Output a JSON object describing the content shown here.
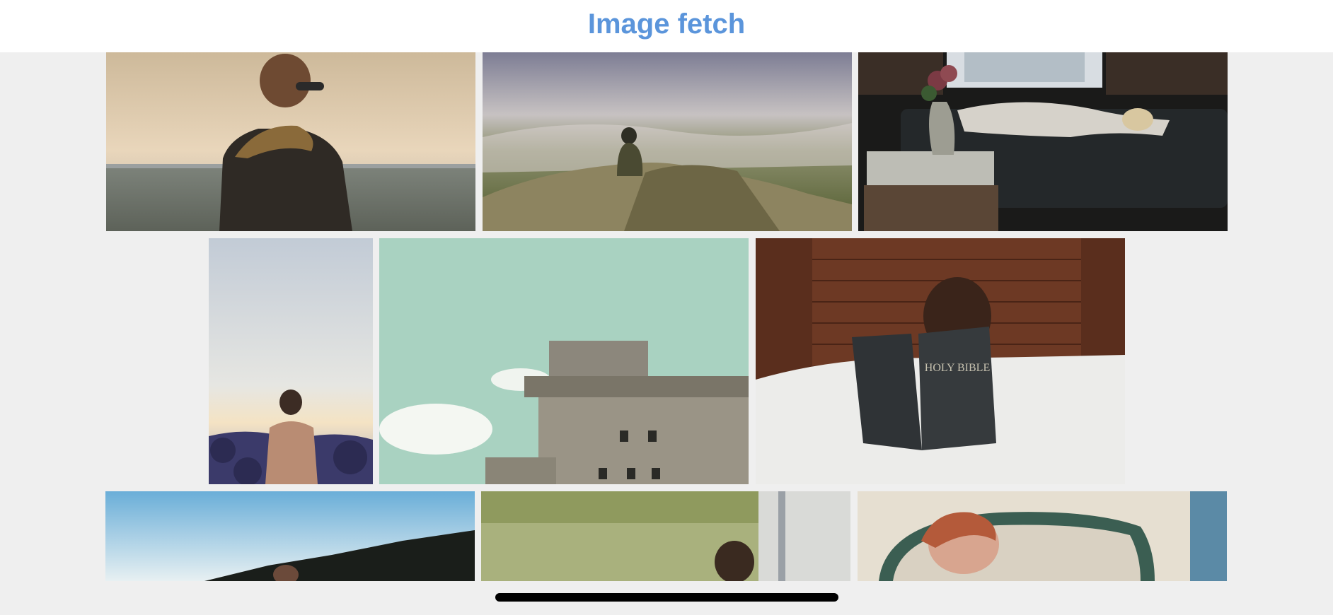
{
  "header": {
    "title": "Image fetch",
    "title_color": "#5b95db"
  },
  "gallery": {
    "photos": [
      {
        "subject": "man-in-scarf-by-sea"
      },
      {
        "subject": "hiker-with-dog-on-misty-mountain"
      },
      {
        "subject": "woman-sleeping-on-sofa"
      },
      {
        "subject": "shirtless-man-on-rocky-shore"
      },
      {
        "subject": "concrete-bunker-building"
      },
      {
        "subject": "child-reading-bible",
        "cover_text": "HOLY BIBLE"
      },
      {
        "subject": "forest-treeline-sky"
      },
      {
        "subject": "person-in-tall-grass"
      },
      {
        "subject": "woman-in-vintage-car"
      }
    ]
  },
  "system": {
    "home_indicator": "home-indicator"
  }
}
